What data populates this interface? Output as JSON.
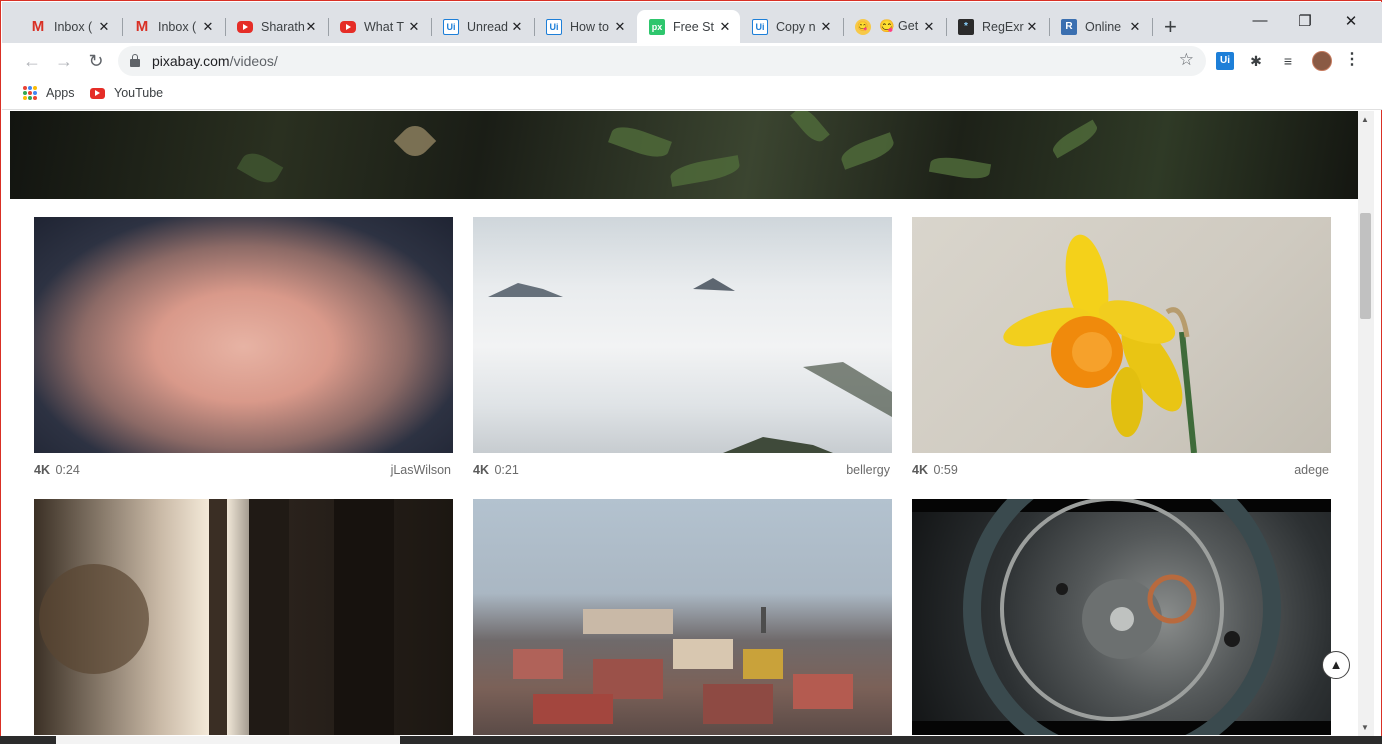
{
  "tabs": [
    {
      "title": "Inbox (",
      "icon": "gmail-icon",
      "active": false
    },
    {
      "title": "Inbox (",
      "icon": "gmail-icon",
      "active": false
    },
    {
      "title": "Sharath",
      "icon": "youtube-icon",
      "active": false
    },
    {
      "title": "What T",
      "icon": "youtube-icon",
      "active": false
    },
    {
      "title": "Unread",
      "icon": "uipath-icon",
      "active": false
    },
    {
      "title": "How to",
      "icon": "uipath-icon",
      "active": false
    },
    {
      "title": "Free St",
      "icon": "pixabay-icon",
      "active": true
    },
    {
      "title": "Copy n",
      "icon": "uipath-icon",
      "active": false
    },
    {
      "title": "😋 Get",
      "icon": "emoji-icon",
      "active": false
    },
    {
      "title": "RegExr",
      "icon": "regexr-icon",
      "active": false
    },
    {
      "title": "Online",
      "icon": "r-icon",
      "active": false
    }
  ],
  "favicon_text": {
    "uipath": "Ui",
    "pixabay": "px",
    "regexr": "*",
    "r": "R",
    "emoji": "😋"
  },
  "toolbar": {
    "url_host": "pixabay.com",
    "url_path": "/videos/",
    "back_icon": "←",
    "forward_icon": "→",
    "reload_icon": "↻",
    "star_icon": "☆",
    "new_tab_icon": "+",
    "minimize_icon": "—",
    "restore_icon": "❐",
    "close_icon": "✕",
    "tab_close_icon": "✕",
    "extensions_icon": "✱",
    "media_icon": "≡",
    "menu_icon": "⋮"
  },
  "bookmarks": {
    "apps": "Apps",
    "youtube": "YouTube"
  },
  "videos": [
    {
      "quality": "4K",
      "duration": "0:24",
      "author": "jLasWilson"
    },
    {
      "quality": "4K",
      "duration": "0:21",
      "author": "bellergy"
    },
    {
      "quality": "4K",
      "duration": "0:59",
      "author": "adege"
    },
    {
      "quality": "",
      "duration": "",
      "author": ""
    },
    {
      "quality": "",
      "duration": "",
      "author": ""
    },
    {
      "quality": "",
      "duration": "",
      "author": ""
    }
  ],
  "scroll_top_icon": "▲",
  "colors": {
    "accent_red": "#d93025",
    "pixabay_green": "#2ec66d",
    "uipath_blue": "#1d7fd8",
    "youtube_red": "#e52d27"
  }
}
